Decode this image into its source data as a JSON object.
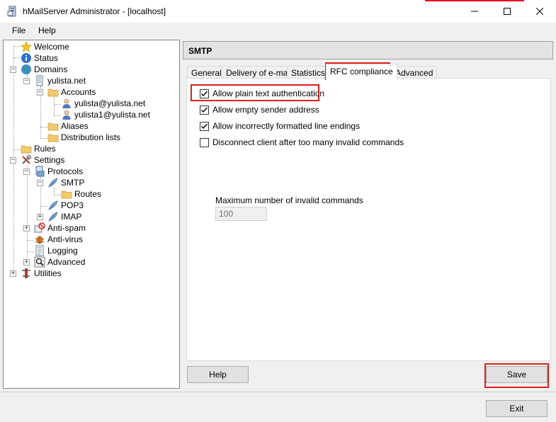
{
  "window": {
    "title": "hMailServer Administrator - [localhost]"
  },
  "menu": {
    "file": "File",
    "help": "Help"
  },
  "tree": {
    "welcome": "Welcome",
    "status": "Status",
    "domains": "Domains",
    "domain_name": "yulista.net",
    "accounts": "Accounts",
    "account_1": "yulista@yulista.net",
    "account_2": "yulista1@yulista.net",
    "aliases": "Aliases",
    "distribution_lists": "Distribution lists",
    "rules": "Rules",
    "settings": "Settings",
    "protocols": "Protocols",
    "smtp": "SMTP",
    "routes": "Routes",
    "pop3": "POP3",
    "imap": "IMAP",
    "anti_spam": "Anti-spam",
    "anti_virus": "Anti-virus",
    "logging": "Logging",
    "advanced": "Advanced",
    "utilities": "Utilities"
  },
  "panel": {
    "header": "SMTP",
    "tabs": [
      "General",
      "Delivery of e-mail",
      "Statistics",
      "RFC compliance",
      "Advanced"
    ],
    "active_tab": "RFC compliance",
    "options": [
      {
        "label": "Allow plain text authentication",
        "checked": true
      },
      {
        "label": "Allow empty sender address",
        "checked": true
      },
      {
        "label": "Allow incorrectly formatted line endings",
        "checked": true
      },
      {
        "label": "Disconnect client after too many invalid commands",
        "checked": false
      }
    ],
    "max_invalid_label": "Maximum number of invalid commands",
    "max_invalid_value": "100",
    "help_button": "Help",
    "save_button": "Save"
  },
  "footer": {
    "exit_button": "Exit"
  },
  "colors": {
    "highlight": "#e0201c",
    "window_bg": "#f0f0f0"
  }
}
